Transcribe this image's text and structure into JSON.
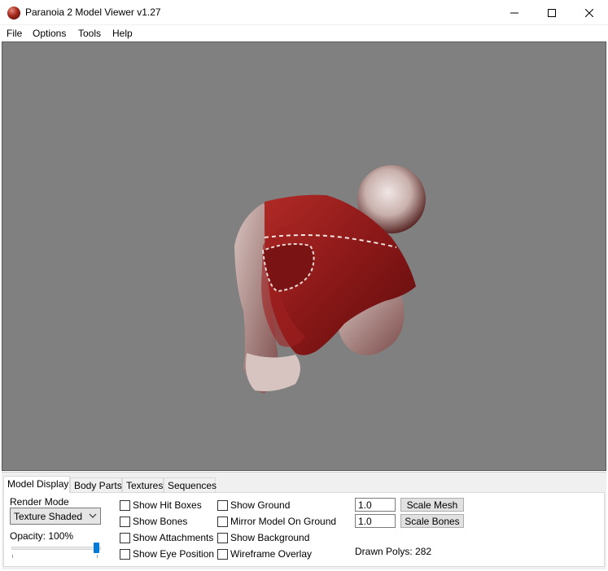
{
  "window": {
    "title": "Paranoia 2 Model Viewer v1.27",
    "minimize_icon": "minimize-icon",
    "maximize_icon": "maximize-icon",
    "close_icon": "close-icon"
  },
  "menu": {
    "items": [
      "File",
      "Options",
      "Tools",
      "Help"
    ]
  },
  "viewport": {
    "background": "#808080",
    "model_colors": {
      "cloth": "#8b1a1a",
      "fur": "#d9c8c4"
    }
  },
  "tabs": [
    "Model Display",
    "Body Parts",
    "Textures",
    "Sequences"
  ],
  "active_tab": "Model Display",
  "model_display": {
    "render_mode_label": "Render Mode",
    "render_mode_value": "Texture Shaded",
    "opacity_label": "Opacity: 100%",
    "opacity_value": 1.0,
    "checkboxes_col1": [
      "Show Hit Boxes",
      "Show Bones",
      "Show Attachments",
      "Show Eye Position"
    ],
    "checkboxes_col2": [
      "Show Ground",
      "Mirror Model On Ground",
      "Show Background",
      "Wireframe Overlay"
    ],
    "scale_mesh_value": "1.0",
    "scale_mesh_button": "Scale Mesh",
    "scale_bones_value": "1.0",
    "scale_bones_button": "Scale Bones",
    "drawn_polys": "Drawn Polys: 282"
  }
}
